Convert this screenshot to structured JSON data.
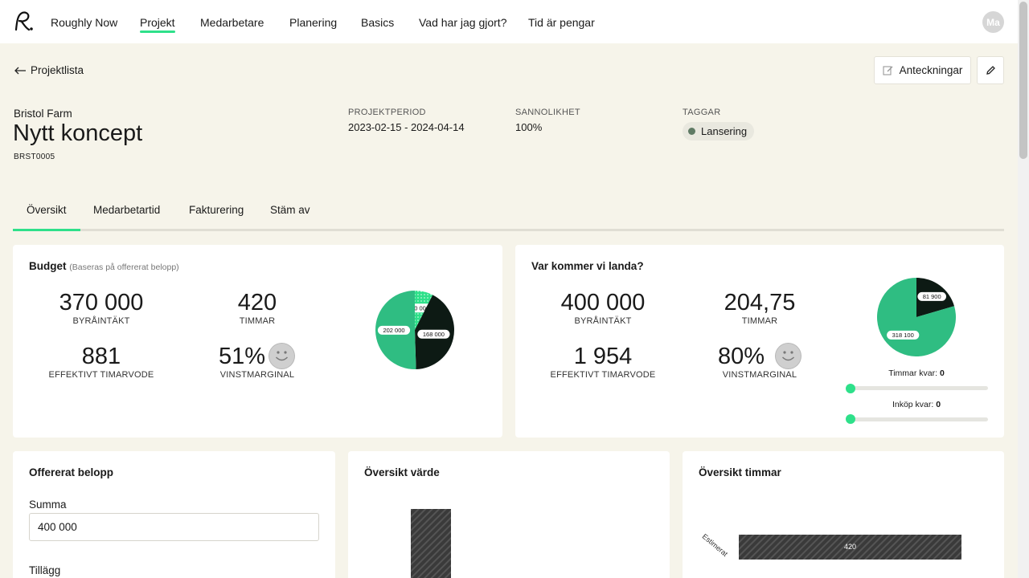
{
  "nav": {
    "items": [
      "Roughly Now",
      "Projekt",
      "Medarbetare",
      "Planering",
      "Basics",
      "Vad har jag gjort?",
      "Tid är pengar"
    ],
    "active_index": 1,
    "avatar": "Ma"
  },
  "header": {
    "back_label": "Projektlista",
    "notes_label": "Anteckningar",
    "client": "Bristol Farm",
    "title": "Nytt koncept",
    "code": "BRST0005",
    "period_label": "PROJEKTPERIOD",
    "period_value": "2023-02-15 - 2024-04-14",
    "probability_label": "SANNOLIKHET",
    "probability_value": "100%",
    "tags_label": "TAGGAR",
    "tag": "Lansering"
  },
  "tabs": [
    "Översikt",
    "Medarbetartid",
    "Fakturering",
    "Stäm av"
  ],
  "budget": {
    "title": "Budget",
    "subtitle": "(Baseras på offererat belopp)",
    "revenue": "370 000",
    "revenue_label": "BYRÅINTÄKT",
    "hours": "420",
    "hours_label": "TIMMAR",
    "rate": "881",
    "rate_label": "EFFEKTIVT TIMARVODE",
    "margin": "51%",
    "margin_label": "VINSTMARGINAL"
  },
  "landing": {
    "title": "Var kommer vi landa?",
    "revenue": "400 000",
    "revenue_label": "BYRÅINTÄKT",
    "hours": "204,75",
    "hours_label": "TIMMAR",
    "rate": "1 954",
    "rate_label": "EFFEKTIVT TIMARVODE",
    "margin": "80%",
    "margin_label": "VINSTMARGINAL",
    "hours_left_label": "Timmar kvar:",
    "hours_left_value": "0",
    "purchase_left_label": "Inköp kvar:",
    "purchase_left_value": "0"
  },
  "offer": {
    "title": "Offererat belopp",
    "sum_label": "Summa",
    "sum_value": "400 000",
    "addition_label": "Tillägg"
  },
  "value_overview": {
    "title": "Översikt värde"
  },
  "hours_overview": {
    "title": "Översikt timmar",
    "bar_category": "Estimerat",
    "bar_value": "420"
  },
  "chart_data": [
    {
      "type": "pie",
      "labels": [
        "30 000",
        "168 000",
        "202 000"
      ],
      "values": [
        30000,
        168000,
        202000
      ],
      "colors": [
        "#2ee08a",
        "#0d1a14",
        "#2fbd82"
      ]
    },
    {
      "type": "pie",
      "labels": [
        "81 900",
        "318 100"
      ],
      "values": [
        81900,
        318100
      ],
      "colors": [
        "#0d1a14",
        "#2fbd82"
      ]
    }
  ],
  "colors": {
    "accent": "#2ee08a",
    "pie_green": "#2fbd82",
    "pie_dark": "#0d1a14",
    "hatched_bar": "#3a3a3a"
  }
}
